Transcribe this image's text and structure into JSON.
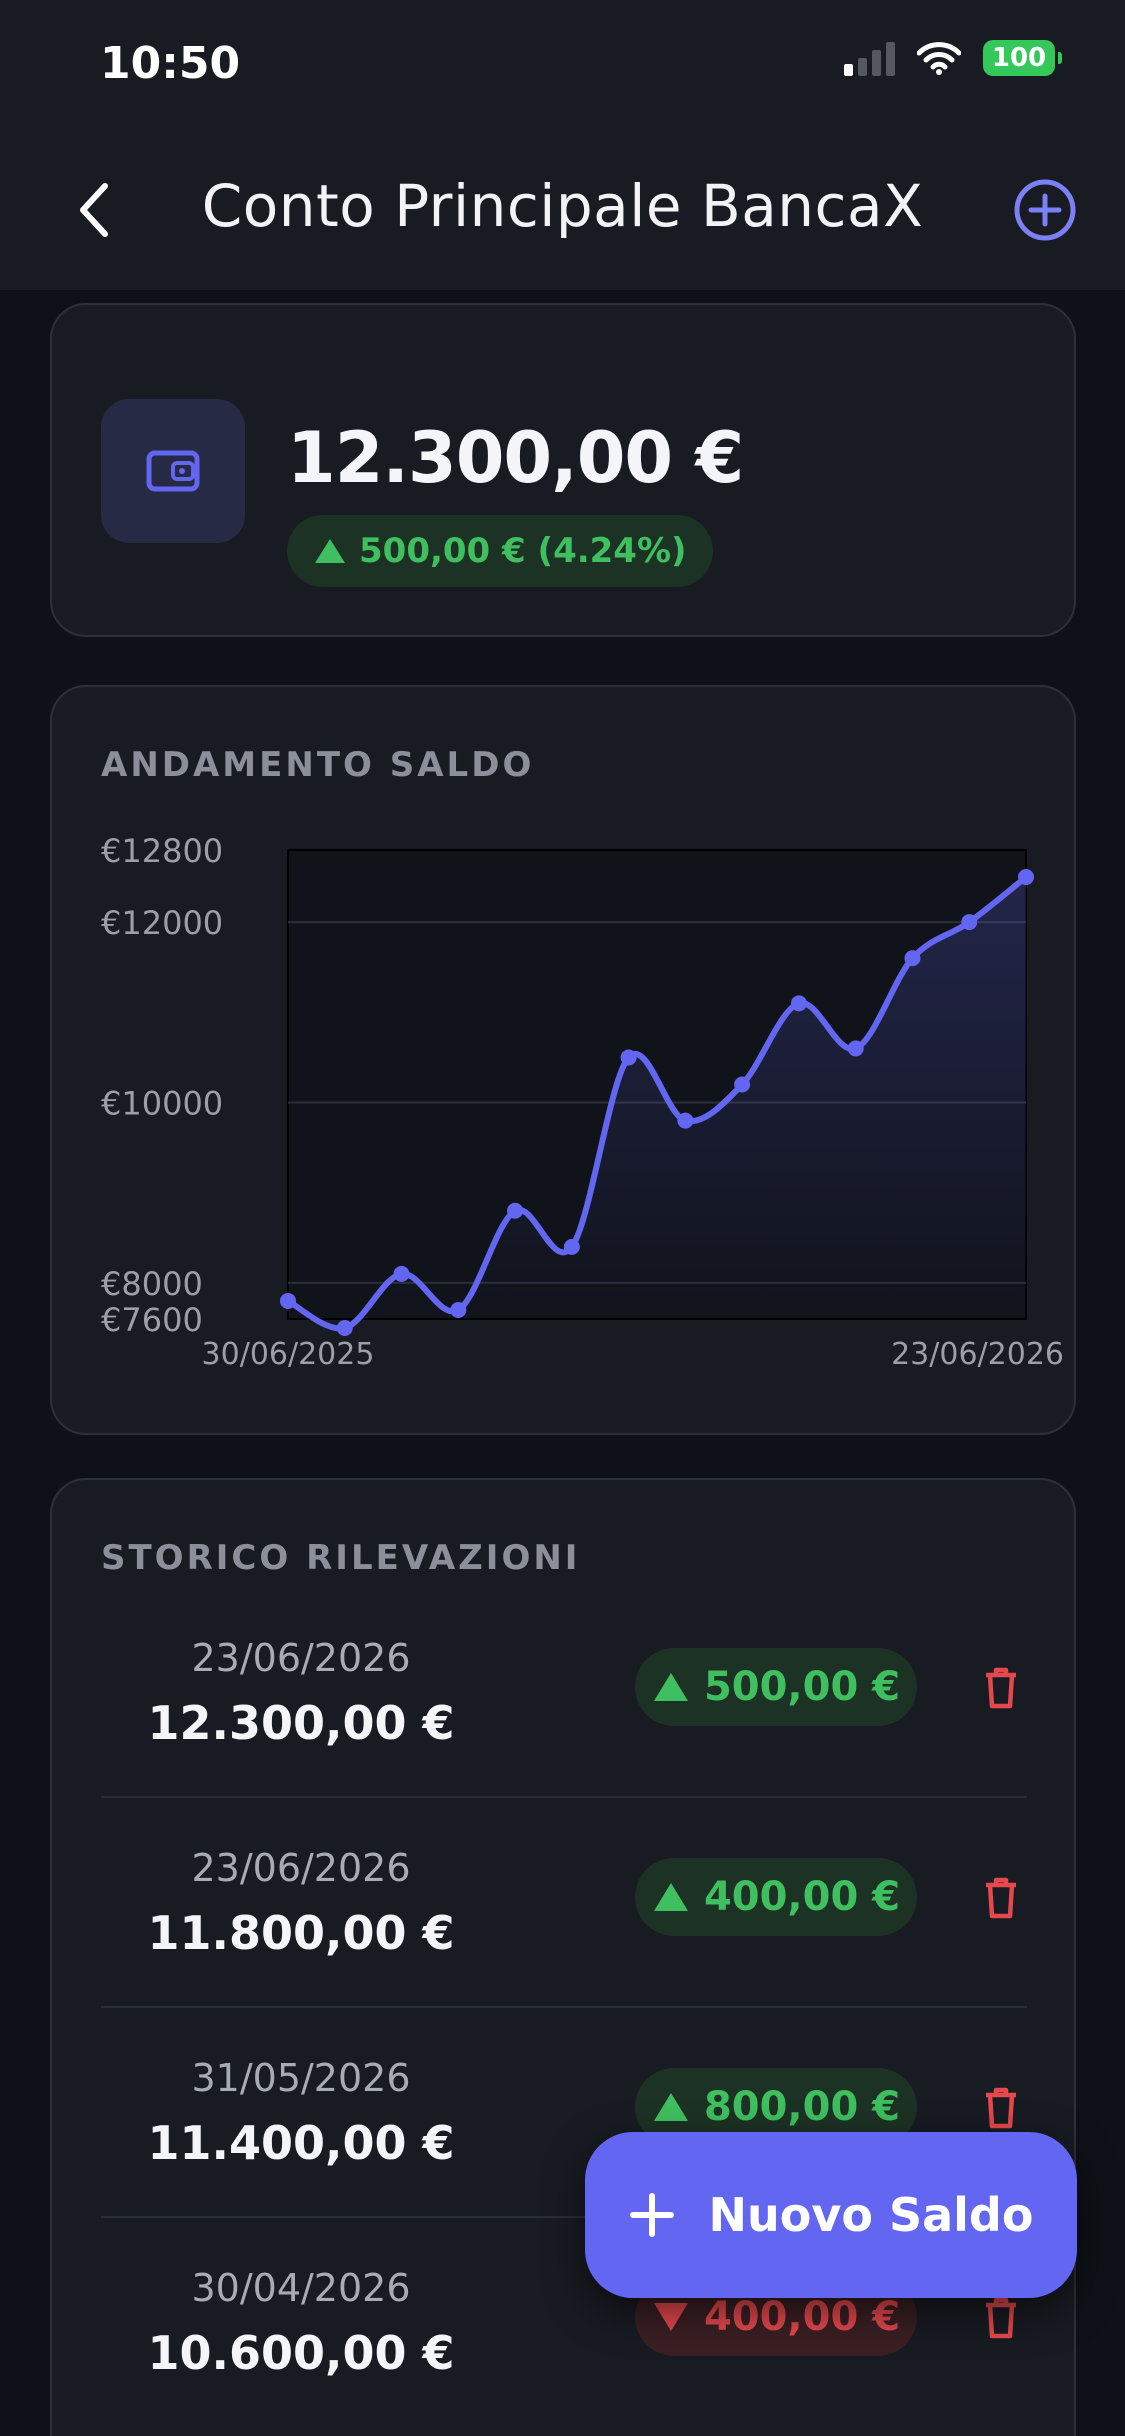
{
  "status_bar": {
    "time": "10:50",
    "battery": "100"
  },
  "header": {
    "title": "Conto Principale BancaX"
  },
  "balance": {
    "amount": "12.300,00 €",
    "change": "500,00 € (4.24%)"
  },
  "chart_section": {
    "title": "ANDAMENTO SALDO"
  },
  "chart_data": {
    "type": "area",
    "title": "ANDAMENTO SALDO",
    "y_tick_labels": [
      "€12800",
      "€12000",
      "€10000",
      "€8000",
      "€7600"
    ],
    "y_ticks": [
      12800,
      12000,
      10000,
      8000,
      7600
    ],
    "ylim": [
      7600,
      12800
    ],
    "x_tick_labels": [
      "30/06/2025",
      "23/06/2026"
    ],
    "grid": true,
    "series": [
      {
        "values": [
          7800,
          7500,
          8100,
          7700,
          8800,
          8400,
          10500,
          9800,
          10200,
          11100,
          10600,
          11600,
          12000,
          12500
        ]
      }
    ],
    "color": "#6366f1"
  },
  "history": {
    "title": "STORICO RILEVAZIONI",
    "rows": [
      {
        "date": "23/06/2026",
        "amount": "12.300,00 €",
        "change": "500,00 €",
        "direction": "up"
      },
      {
        "date": "23/06/2026",
        "amount": "11.800,00 €",
        "change": "400,00 €",
        "direction": "up"
      },
      {
        "date": "31/05/2026",
        "amount": "11.400,00 €",
        "change": "800,00 €",
        "direction": "up"
      },
      {
        "date": "30/04/2026",
        "amount": "10.600,00 €",
        "change": "400,00 €",
        "direction": "down"
      }
    ]
  },
  "fab": {
    "label": "Nuovo Saldo"
  },
  "colors": {
    "accent": "#6366f1",
    "positive": "#3fbf5f",
    "negative": "#e5484d",
    "background": "#0e1117",
    "card": "#181b22"
  }
}
